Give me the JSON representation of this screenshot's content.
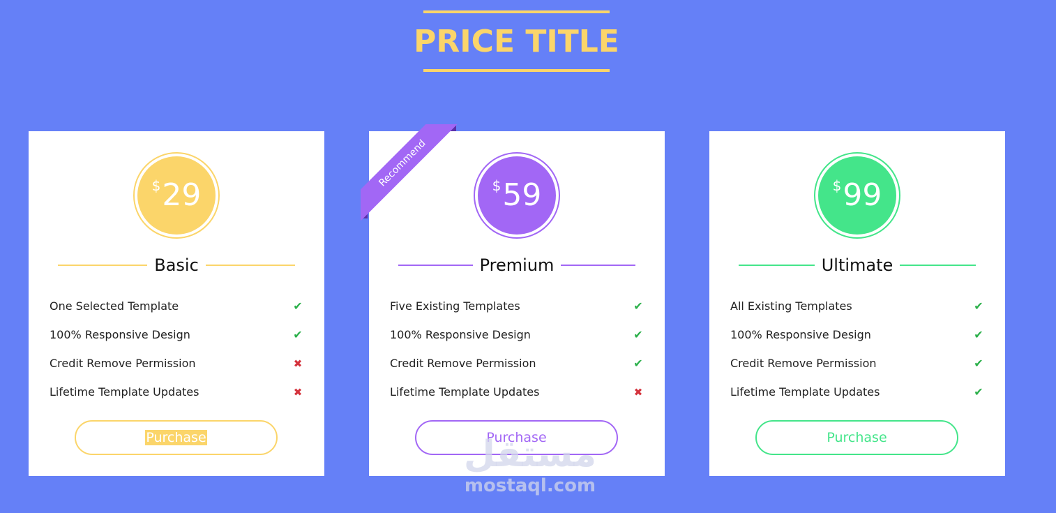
{
  "header": {
    "title": "PRICE TITLE",
    "accent": "#fbd56a"
  },
  "background": "#6580f7",
  "plans": [
    {
      "currency": "$",
      "price": "29",
      "name": "Basic",
      "color": "#fbd56a",
      "features": [
        {
          "label": "One Selected Template",
          "included": true,
          "icon": "check-icon"
        },
        {
          "label": "100% Responsive Design",
          "included": true,
          "icon": "check-icon"
        },
        {
          "label": "Credit Remove Permission",
          "included": false,
          "icon": "cross-icon"
        },
        {
          "label": "Lifetime Template Updates",
          "included": false,
          "icon": "cross-icon"
        }
      ],
      "button_label": "Purchase"
    },
    {
      "currency": "$",
      "price": "59",
      "name": "Premium",
      "color": "#a267f5",
      "ribbon": "Recommend",
      "features": [
        {
          "label": "Five Existing Templates",
          "included": true,
          "icon": "check-icon"
        },
        {
          "label": "100% Responsive Design",
          "included": true,
          "icon": "check-icon"
        },
        {
          "label": "Credit Remove Permission",
          "included": true,
          "icon": "check-icon"
        },
        {
          "label": "Lifetime Template Updates",
          "included": false,
          "icon": "cross-icon"
        }
      ],
      "button_label": "Purchase"
    },
    {
      "currency": "$",
      "price": "99",
      "name": "Ultimate",
      "color": "#44e58a",
      "features": [
        {
          "label": "All Existing Templates",
          "included": true,
          "icon": "check-icon"
        },
        {
          "label": "100% Responsive Design",
          "included": true,
          "icon": "check-icon"
        },
        {
          "label": "Credit Remove Permission",
          "included": true,
          "icon": "check-icon"
        },
        {
          "label": "Lifetime Template Updates",
          "included": true,
          "icon": "check-icon"
        }
      ],
      "button_label": "Purchase"
    }
  ],
  "watermark": {
    "arabic": "مستقل",
    "latin": "mostaql.com"
  }
}
